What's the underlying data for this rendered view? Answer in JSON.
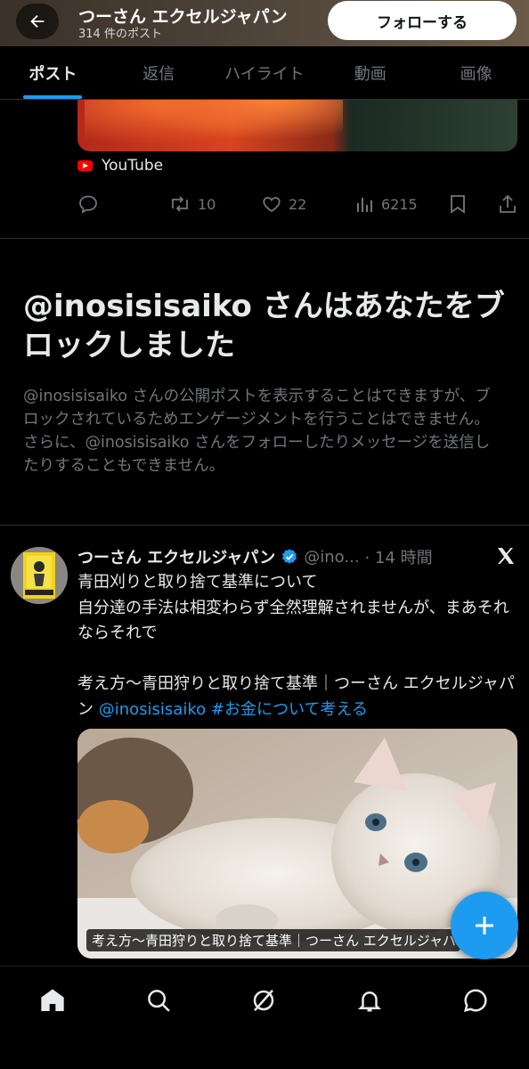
{
  "header": {
    "name": "つーさん エクセルジャパン",
    "post_count": "314 件のポスト",
    "follow_label": "フォローする"
  },
  "tabs": [
    {
      "label": "ポスト",
      "active": true
    },
    {
      "label": "返信",
      "active": false
    },
    {
      "label": "ハイライト",
      "active": false
    },
    {
      "label": "動画",
      "active": false
    },
    {
      "label": "画像",
      "active": false
    }
  ],
  "prev_post": {
    "source_label": "YouTube",
    "retweets": "10",
    "likes": "22",
    "views": "6215"
  },
  "blocked": {
    "title": "@inosisisaiko さんはあなたをブロックしました",
    "body": "@inosisisaiko さんの公開ポストを表示することはできますが、ブロックされているためエンゲージメントを行うことはできません。さらに、@inosisisaiko さんをフォローしたりメッセージを送信したりすることもできません。"
  },
  "tweet": {
    "name": "つーさん エクセルジャパン",
    "handle": "@ino...",
    "time": "· 14 時間",
    "line1": "青田刈りと取り捨て基準について",
    "line2": "自分達の手法は相変わらず全然理解されませんが、まあそれならそれで",
    "line3": "考え方～青田狩りと取り捨て基準｜つーさん エクセルジャパン",
    "mention": "@inosisisaiko",
    "hashtag": "#お金について考える",
    "card_title": "考え方～青田狩りと取り捨て基準｜つーさん エクセルジャパ",
    "card_cut": "青田..."
  },
  "colors": {
    "accent": "#1d9bf0",
    "muted": "#71767b",
    "background": "#000000"
  },
  "icons": {
    "back": "arrow-left-icon",
    "reply": "reply-icon",
    "retweet": "retweet-icon",
    "like": "heart-icon",
    "views": "bar-chart-icon",
    "bookmark": "bookmark-icon",
    "share": "share-icon",
    "x": "x-logo-icon",
    "compose": "plus-icon",
    "nav": [
      "home-icon",
      "search-icon",
      "grok-icon",
      "bell-icon",
      "message-icon"
    ]
  }
}
